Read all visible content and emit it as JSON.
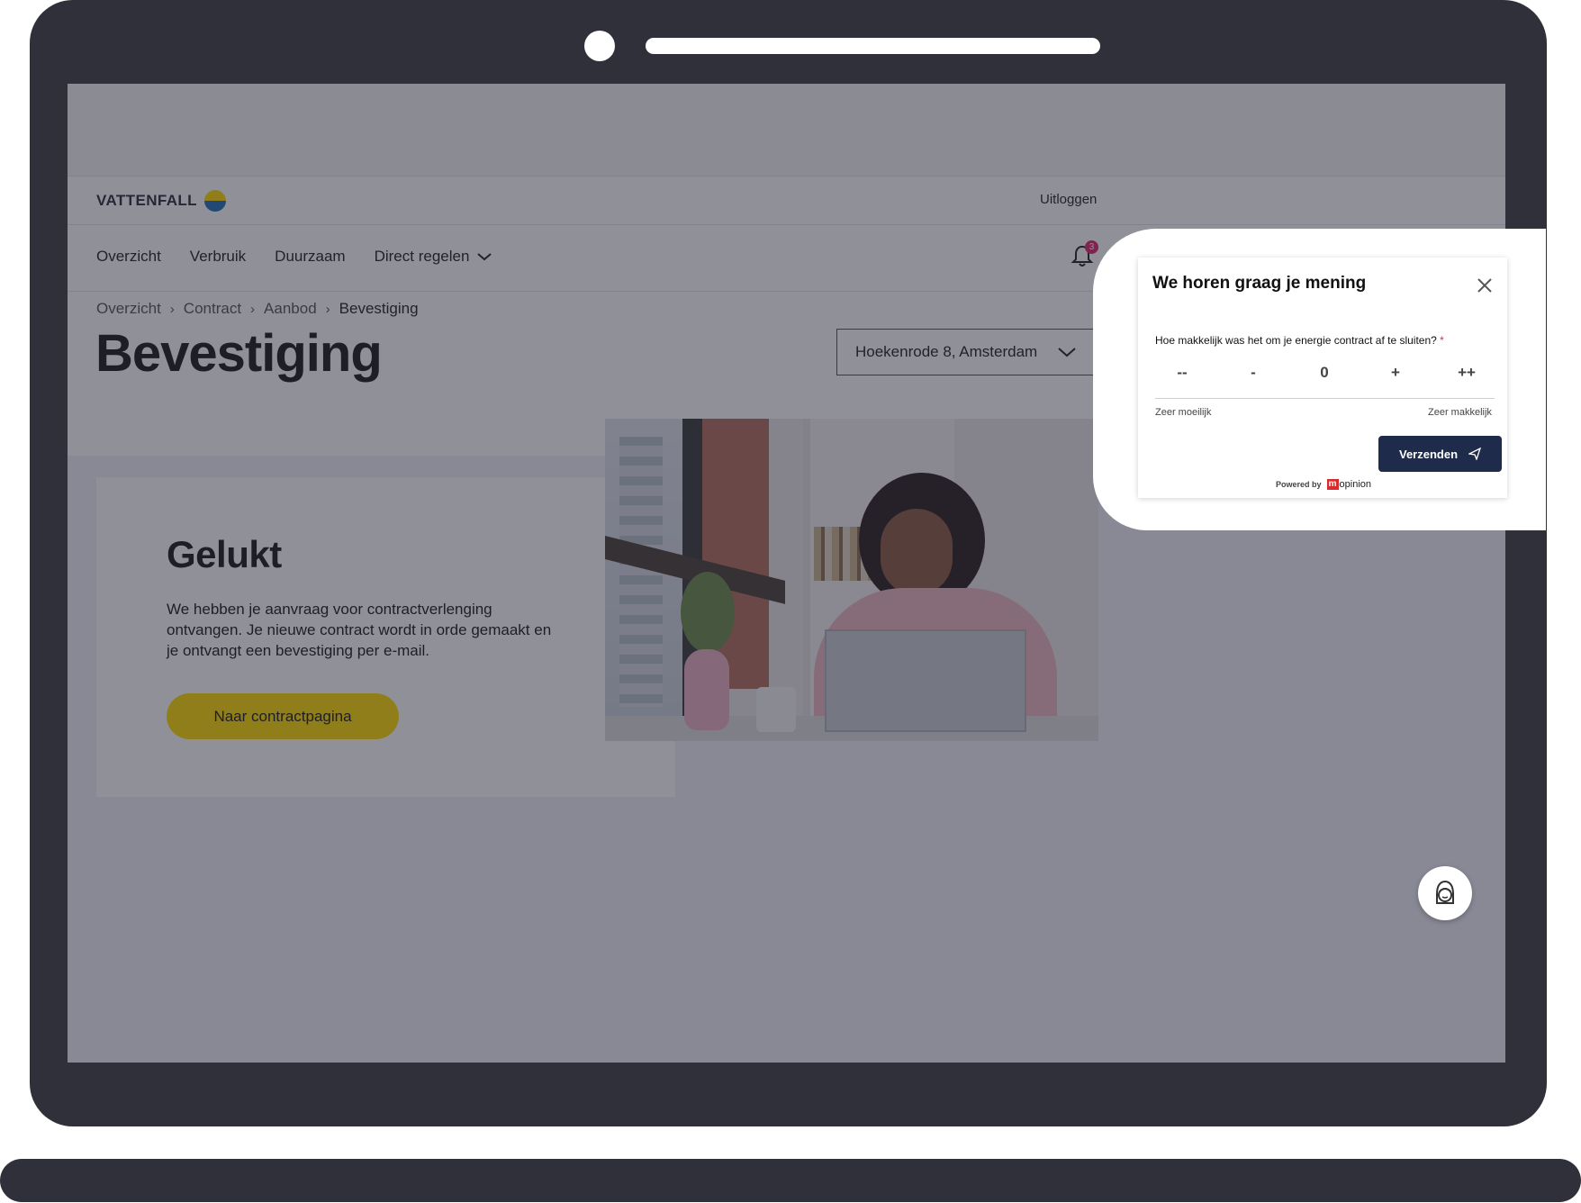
{
  "brand": {
    "name": "VATTENFALL",
    "logo_colors": [
      "#ffda00",
      "#2071b5"
    ]
  },
  "header": {
    "logout_label": "Uitloggen"
  },
  "nav": {
    "items": [
      "Overzicht",
      "Verbruik",
      "Duurzaam"
    ],
    "dropdown_label": "Direct regelen",
    "notification_count": "3"
  },
  "breadcrumb": [
    "Overzicht",
    "Contract",
    "Aanbod",
    "Bevestiging"
  ],
  "page": {
    "title": "Bevestiging",
    "address_selector": "Hoekenrode 8, Amsterdam"
  },
  "card": {
    "title": "Gelukt",
    "text": "We hebben je aanvraag voor contractverlenging ontvangen. Je nieuwe contract wordt in orde gemaakt en je ontvangt een bevestiging per e-mail.",
    "button_label": "Naar contractpagina",
    "button_color": "#ffda00"
  },
  "feedback": {
    "title": "We horen graag je mening",
    "question": "Hoe makkelijk was het om je energie contract af te sluiten?",
    "required_marker": "*",
    "scale": [
      "--",
      "-",
      "0",
      "+",
      "++"
    ],
    "label_low": "Zeer moeilijk",
    "label_high": "Zeer makkelijk",
    "send_label": "Verzenden",
    "powered_by": "Powered by",
    "provider": "opinion",
    "provider_mark": "m",
    "send_button_color": "#1e2b4a"
  },
  "icons": {
    "bell": "bell-icon",
    "chevron": "chevron-down-icon",
    "close": "close-icon",
    "send": "send-icon",
    "chat": "chat-agent-icon"
  }
}
